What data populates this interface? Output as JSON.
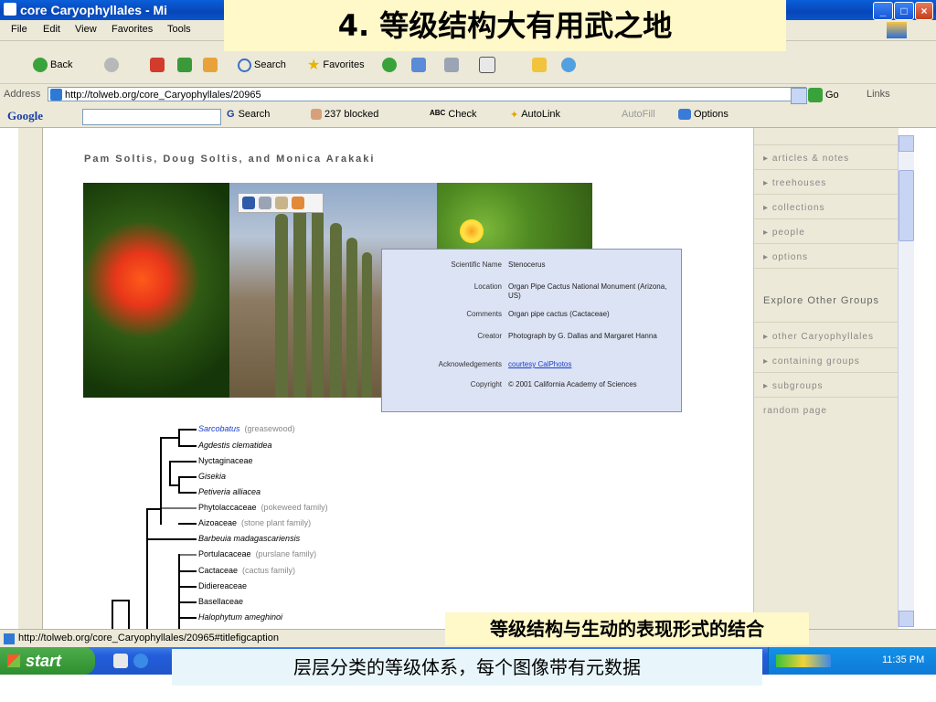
{
  "window": {
    "title": "core Caryophyllales - Mi"
  },
  "overlays": {
    "slide_title": "4. 等级结构大有用武之地",
    "caption": "等级结构与生动的表现形式的结合",
    "subtitle": "层层分类的等级体系，每个图像带有元数据"
  },
  "menu": [
    "File",
    "Edit",
    "View",
    "Favorites",
    "Tools"
  ],
  "toolbar": {
    "back": "Back",
    "search": "Search",
    "favorites": "Favorites"
  },
  "address": {
    "label": "Address",
    "url": "http://tolweb.org/core_Caryophyllales/20965",
    "go": "Go",
    "links": "Links"
  },
  "googlebar": {
    "brand": "Google",
    "search": "Search",
    "blocked": "237 blocked",
    "check": "Check",
    "autolink": "AutoLink",
    "autofill": "AutoFill",
    "options": "Options"
  },
  "page": {
    "authors": "Pam Soltis, Doug Soltis, and Monica Arakaki",
    "image_info": [
      {
        "k": "Scientific Name",
        "v": "Stenocerus"
      },
      {
        "k": "Location",
        "v": "Organ Pipe Cactus National Monument (Arizona, US)"
      },
      {
        "k": "Comments",
        "v": "Organ pipe cactus (Cactaceae)"
      },
      {
        "k": "Creator",
        "v": "Photograph by G. Dallas and Margaret Hanna"
      },
      {
        "k": "Acknowledgements",
        "v": "courtesy CalPhotos"
      },
      {
        "k": "Copyright",
        "v": "© 2001 California Academy of Sciences"
      }
    ],
    "tree": [
      {
        "name": "Sarcobatus",
        "common": "(greasewood)"
      },
      {
        "name": "Agdestis clematidea",
        "common": ""
      },
      {
        "name": "Nyctaginaceae",
        "common": ""
      },
      {
        "name": "Gisekia",
        "common": ""
      },
      {
        "name": "Petiveria alliacea",
        "common": ""
      },
      {
        "name": "Phytolaccaceae",
        "common": "(pokeweed family)"
      },
      {
        "name": "Aizoaceae",
        "common": "(stone plant family)"
      },
      {
        "name": "Barbeuia madagascariensis",
        "common": ""
      },
      {
        "name": "Portulacaceae",
        "common": "(purslane family)"
      },
      {
        "name": "Cactaceae",
        "common": "(cactus family)"
      },
      {
        "name": "Didiereaceae",
        "common": ""
      },
      {
        "name": "Basellaceae",
        "common": ""
      },
      {
        "name": "Halophytum ameghinoi",
        "common": ""
      }
    ]
  },
  "sidebar": {
    "items": [
      "articles & notes",
      "treehouses",
      "collections",
      "people",
      "options"
    ],
    "explore": "Explore Other Groups",
    "items2": [
      "other Caryophyllales",
      "containing groups",
      "subgroups"
    ],
    "random": "random page"
  },
  "status": {
    "text": "http://tolweb.org/core_Caryophyllales/20965#titlefigcaption"
  },
  "taskbar": {
    "start": "start",
    "clock": "11:35 PM"
  }
}
